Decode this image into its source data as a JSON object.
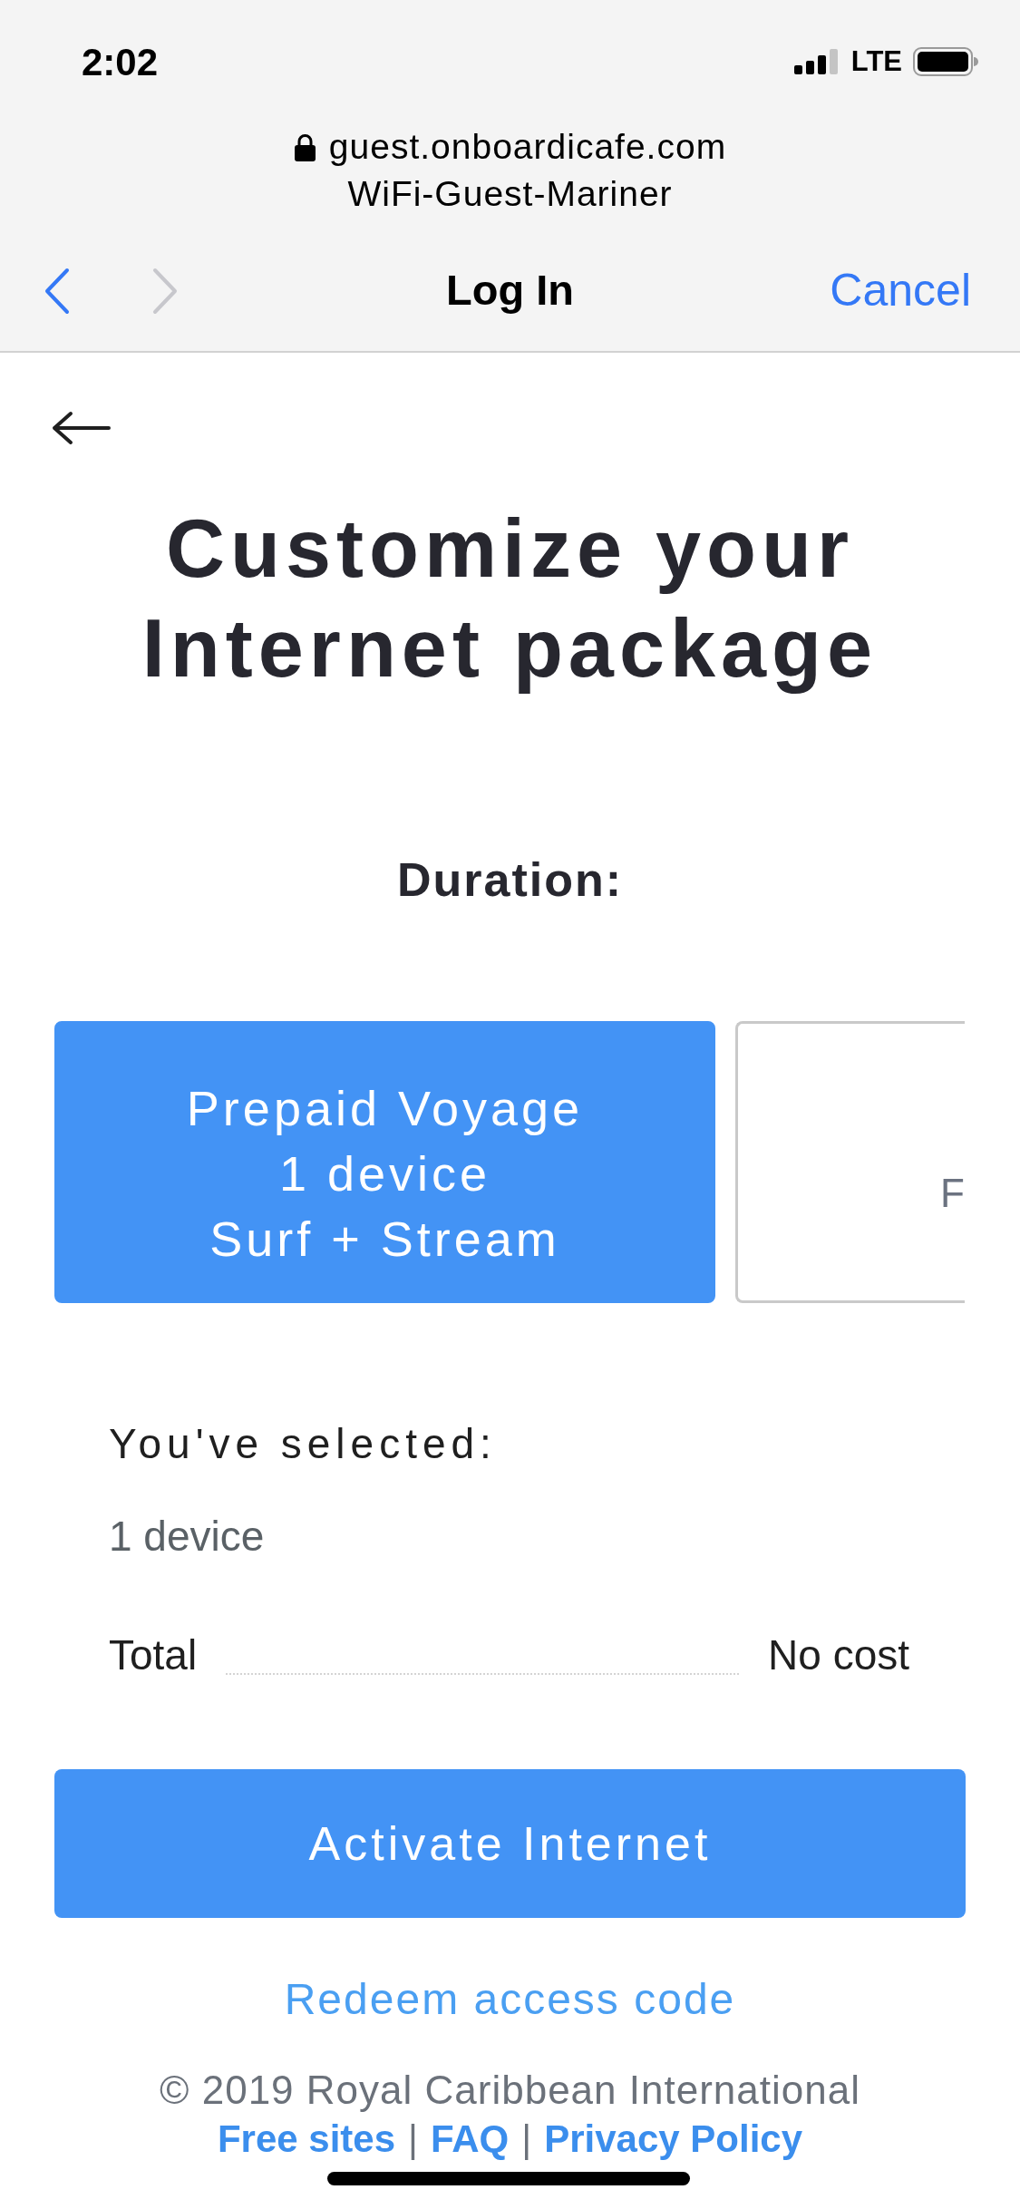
{
  "status_bar": {
    "time": "2:02",
    "network": "LTE"
  },
  "browser_header": {
    "address": "guest.onboardicafe.com",
    "network_name": "WiFi-Guest-Mariner",
    "title": "Log In",
    "cancel": "Cancel",
    "nav_buttons": [
      {
        "kind": "back",
        "disabled": false
      },
      {
        "kind": "forward",
        "disabled": true
      }
    ]
  },
  "page": {
    "title": "Customize your Internet package",
    "duration_label": "Duration:",
    "packages": [
      {
        "lines": [
          "Prepaid Voyage",
          "1 device",
          "Surf + Stream"
        ],
        "selected": true
      },
      {
        "lines": [
          "F"
        ],
        "selected": false
      }
    ],
    "summary": {
      "heading": "You've selected:",
      "items": [
        "1 device"
      ],
      "total_label": "Total",
      "total_value": "No cost"
    },
    "primary_button": "Activate Internet",
    "secondary_link": "Redeem access code"
  },
  "footer": {
    "copyright": "© 2019 Royal Caribbean International",
    "links": [
      "Free sites",
      "FAQ",
      "Privacy Policy"
    ],
    "separator": "|"
  }
}
